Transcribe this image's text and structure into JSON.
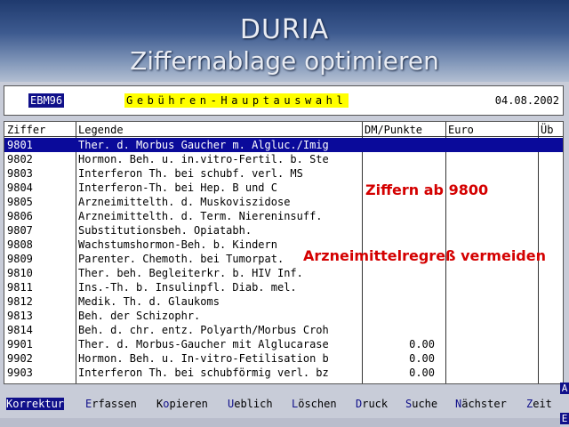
{
  "banner": {
    "title": "DURIA",
    "subtitle": "Ziffernablage optimieren"
  },
  "header": {
    "code": "EBM96",
    "title": "Gebühren-Hauptauswahl",
    "date": "04.08.2002"
  },
  "table": {
    "columns": [
      "Ziffer",
      "Legende",
      "DM/Punkte",
      "Euro",
      "Üb"
    ],
    "rows": [
      {
        "code": "9801",
        "legend": "Ther. d. Morbus Gaucher m. Algluc./Imig",
        "points": ""
      },
      {
        "code": "9802",
        "legend": "Hormon. Beh. u. in.vitro-Fertil. b. Ste",
        "points": ""
      },
      {
        "code": "9803",
        "legend": "Interferon Th. bei schubf. verl. MS",
        "points": ""
      },
      {
        "code": "9804",
        "legend": "Interferon-Th. bei Hep. B und C",
        "points": ""
      },
      {
        "code": "9805",
        "legend": "Arzneimittelth. d. Muskoviszidose",
        "points": ""
      },
      {
        "code": "9806",
        "legend": "Arzneimittelth. d. Term. Niereninsuff.",
        "points": ""
      },
      {
        "code": "9807",
        "legend": "Substitutionsbeh. Opiatabh.",
        "points": ""
      },
      {
        "code": "9808",
        "legend": "Wachstumshormon-Beh. b. Kindern",
        "points": ""
      },
      {
        "code": "9809",
        "legend": "Parenter. Chemoth. bei Tumorpat.",
        "points": ""
      },
      {
        "code": "9810",
        "legend": "Ther. beh. Begleiterkr. b. HIV Inf.",
        "points": ""
      },
      {
        "code": "9811",
        "legend": "Ins.-Th. b. Insulinpfl. Diab. mel.",
        "points": ""
      },
      {
        "code": "9812",
        "legend": "Medik. Th. d. Glaukoms",
        "points": ""
      },
      {
        "code": "9813",
        "legend": "Beh. der Schizophr.",
        "points": ""
      },
      {
        "code": "9814",
        "legend": "Beh. d. chr. entz. Polyarth/Morbus Croh",
        "points": ""
      },
      {
        "code": "9901",
        "legend": "Ther. d. Morbus-Gaucher mit Alglucarase",
        "points": "0.00"
      },
      {
        "code": "9902",
        "legend": "Hormon. Beh. u. In-vitro-Fetilisation b",
        "points": "0.00"
      },
      {
        "code": "9903",
        "legend": "Interferon Th. bei schubförmig verl. bz",
        "points": "0.00"
      }
    ]
  },
  "annotations": {
    "a1": "Ziffern ab 9800",
    "a2": "Arzneimittelregreß vermeiden"
  },
  "menu": {
    "items": [
      {
        "hk": "K",
        "rest": "orrektur"
      },
      {
        "hk": "E",
        "rest": "rfassen"
      },
      {
        "pre": "K",
        "hk": "o",
        "rest": "pieren"
      },
      {
        "hk": "U",
        "rest": "eblich"
      },
      {
        "hk": "L",
        "rest": "öschen"
      },
      {
        "hk": "D",
        "rest": "ruck"
      },
      {
        "hk": "S",
        "rest": "uche"
      },
      {
        "hk": "N",
        "rest": "ächster"
      },
      {
        "hk": "Z",
        "rest": "eit"
      }
    ]
  },
  "side_markers": {
    "top": "A",
    "bottom": "E"
  },
  "colors": {
    "selection": "#0a0a9a",
    "hotkey": "#10108a",
    "annotation": "#d40000",
    "title_highlight": "#ffff00"
  }
}
